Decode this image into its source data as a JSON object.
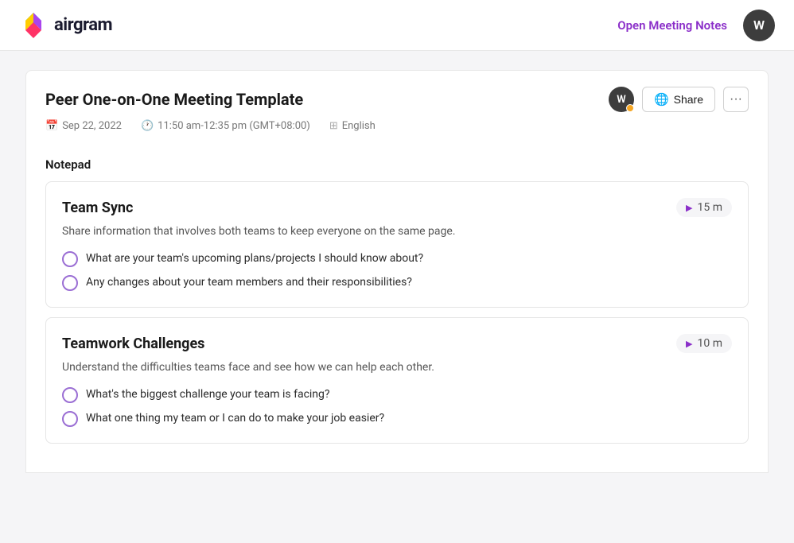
{
  "header": {
    "logo_text": "airgram",
    "open_meeting_label": "Open Meeting Notes",
    "avatar_initial": "W"
  },
  "document": {
    "title": "Peer One-on-One Meeting Template",
    "avatar_initial": "W",
    "share_label": "Share",
    "more_label": "···",
    "meta": {
      "date": "Sep 22, 2022",
      "time": "11:50 am-12:35 pm (GMT+08:00)",
      "language": "English"
    }
  },
  "notepad": {
    "label": "Notepad",
    "agendas": [
      {
        "title": "Team Sync",
        "duration": "15 m",
        "description": "Share information that involves both teams to keep everyone on the same page.",
        "items": [
          "What are your team's upcoming plans/projects I should know about?",
          "Any changes about your team members and their responsibilities?"
        ]
      },
      {
        "title": "Teamwork Challenges",
        "duration": "10 m",
        "description": "Understand the difficulties teams face and see how we can help each other.",
        "items": [
          "What's the biggest challenge your team is facing?",
          "What one thing my team or I can do to make your job easier?"
        ]
      }
    ]
  }
}
